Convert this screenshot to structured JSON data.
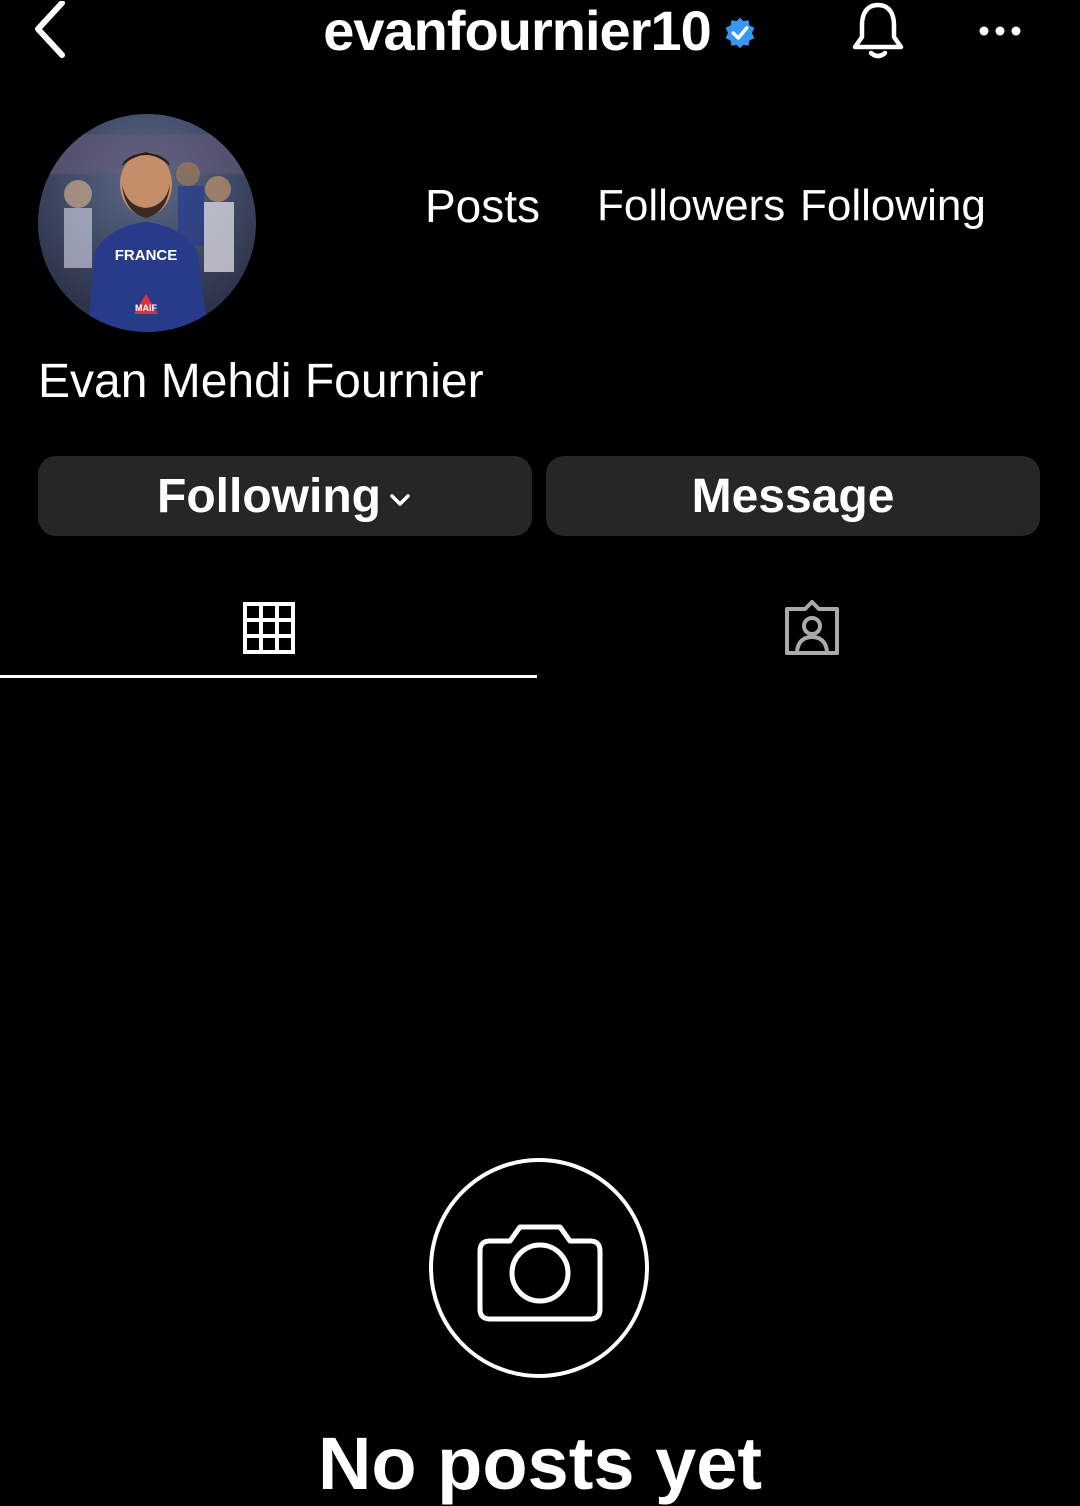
{
  "header": {
    "username": "evanfournier10",
    "back_icon": "chevron-left-icon",
    "verified_icon": "verified-badge-icon",
    "notification_icon": "bell-icon",
    "more_icon": "more-horizontal-icon"
  },
  "profile": {
    "avatar_label": "profile-photo",
    "display_name": "Evan Mehdi Fournier"
  },
  "stats": {
    "posts_label": "Posts",
    "followers_label": "Followers",
    "following_label": "Following"
  },
  "actions": {
    "following_label": "Following",
    "message_label": "Message"
  },
  "tabs": [
    {
      "icon": "grid-icon",
      "active": true
    },
    {
      "icon": "tagged-person-icon",
      "active": false
    }
  ],
  "empty_state": {
    "icon": "camera-icon",
    "title": "No posts yet"
  },
  "colors": {
    "background": "#000000",
    "text": "#ffffff",
    "button_bg": "#262626",
    "verified": "#3897f0"
  }
}
